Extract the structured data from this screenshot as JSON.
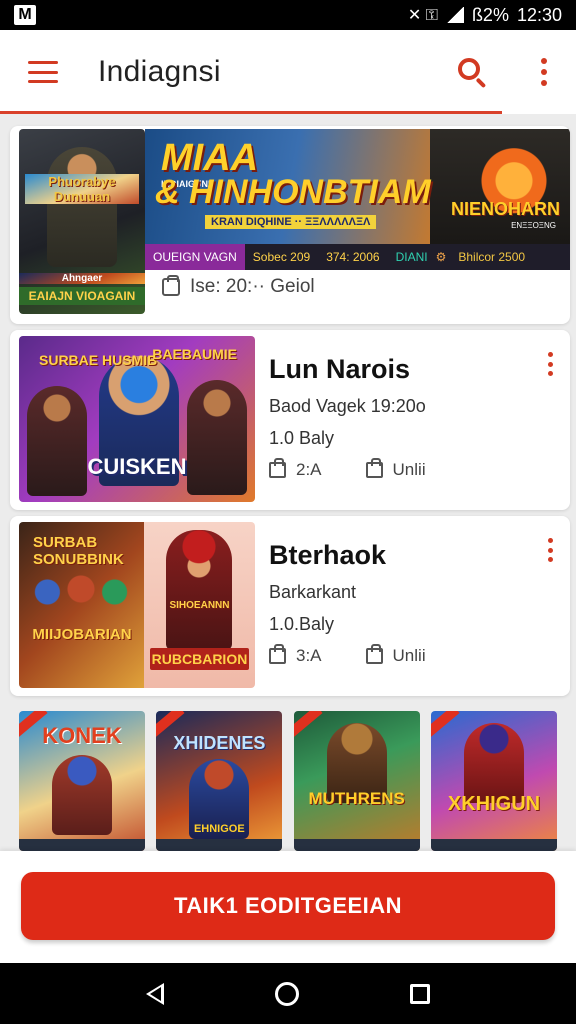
{
  "status_bar": {
    "logo": "M",
    "indicators": "✕ ⚿ ",
    "battery": "ß2%",
    "time": "12:30"
  },
  "app_bar": {
    "title": "Indiagnsi",
    "icons": [
      "menu-icon",
      "search-icon",
      "more-vert-icon"
    ]
  },
  "featured": {
    "poster_text": "Phuorabye Dunuuan",
    "poster_caption": "Ahngaer",
    "poster_badge": "EAIAJN VIOAGAIN",
    "banner_title": "MIAA",
    "banner_subtitle": "INDIAIGUNE",
    "banner_title2": "& HINHONBTIAM",
    "banner_strip": "KRAN DIQHINE ·· ΞΞΛΛΛΛΛΞΛ",
    "banner_right_title": "NIENOHARN",
    "banner_right_sub": "ENΞΞOΞNG",
    "stats": [
      "OUEIGN VAGN",
      "Sobec 209",
      "374: 2006",
      "DIANI",
      "Bhilcor 2500"
    ],
    "meta_text": "Ise: 20:·· Geiol"
  },
  "list_items": [
    {
      "thumb_top_left": "SURBAE HUSMIB",
      "thumb_top_right": "BAEBAUMIE",
      "thumb_logo": "CUISKEN",
      "title": "Lun Narois",
      "subtitle": "Baod Vagek 19:20o",
      "count": "1.0 Baly",
      "likes": "2:A",
      "comments": "Unlii"
    },
    {
      "thumb_top_left": "SURBAB SONUBBINK",
      "thumb_bottom": "MIIJOBARIAN",
      "thumb_warrior_text": "SIHOEANNN",
      "thumb_warrior_badge": "RUBCBARION",
      "title": "Bterhaok",
      "subtitle": "Barkarkant",
      "count": "1.0.Baly",
      "likes": "3:A",
      "comments": "Unlii"
    }
  ],
  "grid_tiles": [
    {
      "title": "KONEK"
    },
    {
      "title": "XHIDENES",
      "sub": "EHNIGOE"
    },
    {
      "title": "MUTHRENS"
    },
    {
      "title": "XKHIGUN"
    }
  ],
  "cta": {
    "label": "TAIK1 EODITGEEIAN"
  },
  "nav_bar": {
    "icons": [
      "back-icon",
      "home-icon",
      "recents-icon"
    ]
  },
  "colors": {
    "accent": "#de2a17",
    "icon_red": "#d23a22",
    "status_bar": "#000000"
  }
}
